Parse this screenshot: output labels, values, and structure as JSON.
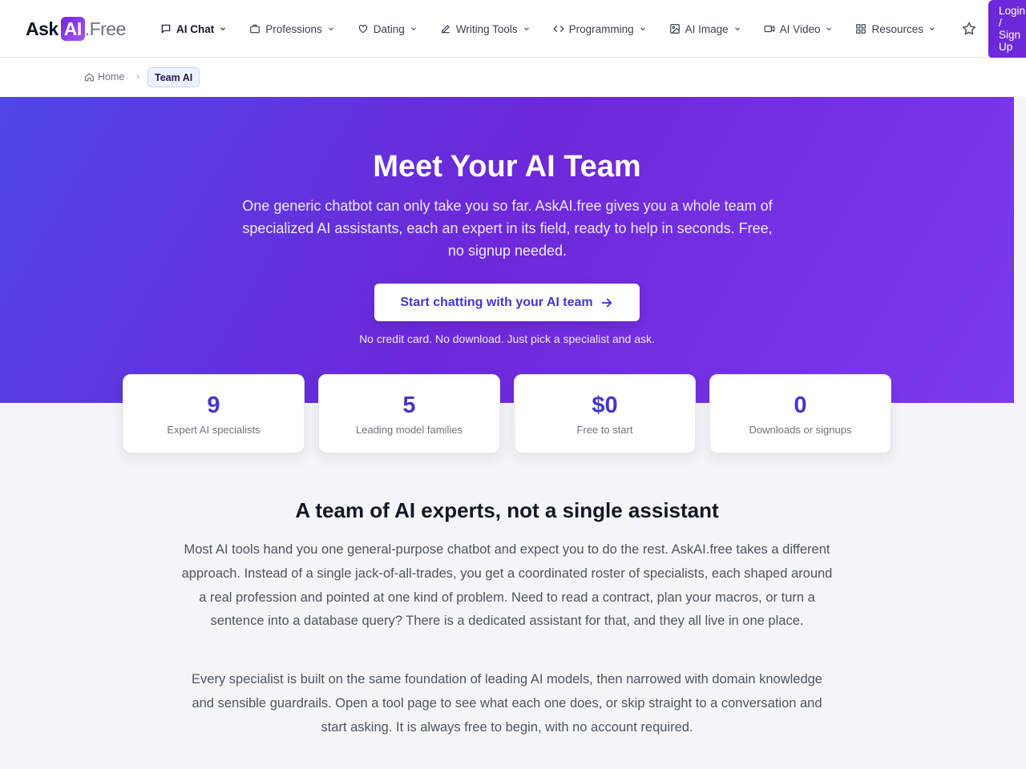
{
  "header": {
    "logo": {
      "ask": "Ask",
      "ai": "AI",
      "free": ".Free"
    },
    "nav": [
      {
        "label": "AI Chat",
        "icon": "chat-bubble-icon",
        "active": true
      },
      {
        "label": "Professions",
        "icon": "briefcase-icon"
      },
      {
        "label": "Dating",
        "icon": "heart-icon"
      },
      {
        "label": "Writing Tools",
        "icon": "pencil-icon"
      },
      {
        "label": "Programming",
        "icon": "code-icon"
      },
      {
        "label": "AI Image",
        "icon": "image-icon"
      },
      {
        "label": "AI Video",
        "icon": "video-camera-icon"
      },
      {
        "label": "Resources",
        "icon": "grid-icon"
      }
    ],
    "favorite_icon": "star-icon",
    "login": {
      "line1": "Login",
      "line2": "/",
      "line3": "Sign",
      "line4": "Up"
    }
  },
  "breadcrumb": {
    "home": "Home",
    "current": "Team AI"
  },
  "hero": {
    "title": "Meet Your AI Team",
    "subtitle": "One generic chatbot can only take you so far. AskAI.free gives you a whole team of specialized AI assistants, each an expert in its field, ready to help in seconds. Free, no signup needed.",
    "cta": "Start chatting with your AI team",
    "note": "No credit card. No download. Just pick a specialist and ask."
  },
  "stats": [
    {
      "value": "9",
      "label": "Expert AI specialists"
    },
    {
      "value": "5",
      "label": "Leading model families"
    },
    {
      "value": "$0",
      "label": "Free to start"
    },
    {
      "value": "0",
      "label": "Downloads or signups"
    }
  ],
  "section": {
    "title": "A team of AI experts, not a single assistant",
    "paragraphs": [
      "Most AI tools hand you one general-purpose chatbot and expect you to do the rest. AskAI.free takes a different approach. Instead of a single jack-of-all-trades, you get a coordinated roster of specialists, each shaped around a real profession and pointed at one kind of problem. Need to read a contract, plan your macros, or turn a sentence into a database query? There is a dedicated assistant for that, and they all live in one place.",
      "Every specialist is built on the same foundation of leading AI models, then narrowed with domain knowledge and sensible guardrails. Open a tool page to see what each one does, or skip straight to a conversation and start asking. It is always free to begin, with no account required."
    ]
  },
  "colors": {
    "brand": "#6d28d9",
    "accent": "#4338ca",
    "hero_start": "#4f46e5",
    "hero_end": "#7c3aed"
  }
}
